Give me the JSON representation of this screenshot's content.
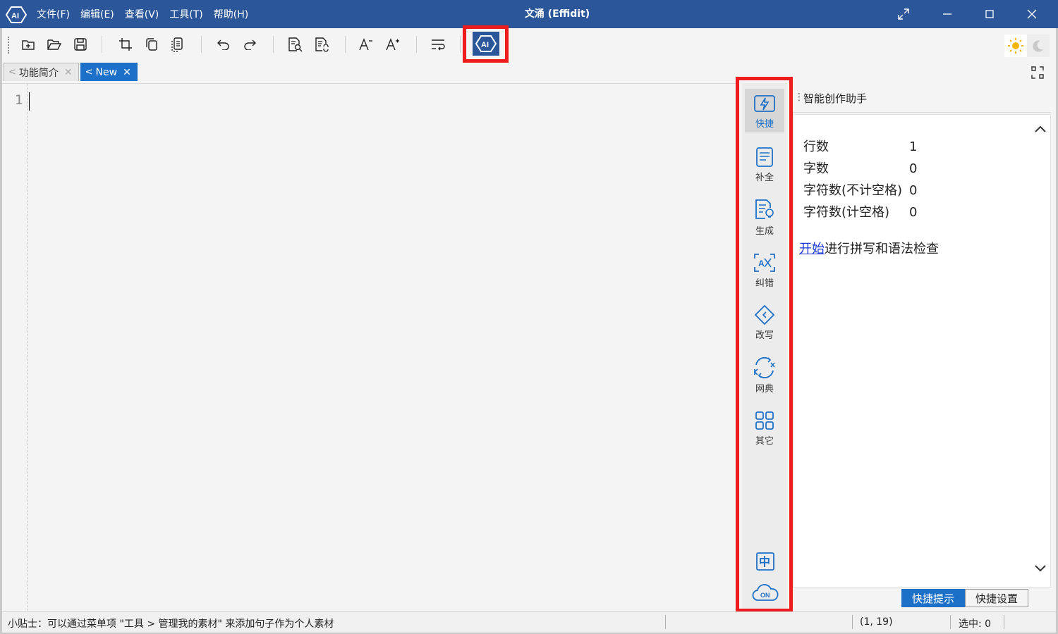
{
  "window": {
    "title": "文涌 (Effidit)",
    "menu": [
      "文件(F)",
      "编辑(E)",
      "查看(V)",
      "工具(T)",
      "帮助(H)"
    ]
  },
  "toolbar": {
    "buttons": [
      "new-file-icon",
      "open-folder-icon",
      "save-icon",
      "crop-icon",
      "copy-icon",
      "paste-icon",
      "undo-icon",
      "redo-icon",
      "find-icon",
      "replace-icon",
      "decrease-font-icon",
      "increase-font-icon",
      "word-wrap-icon",
      "ai-assistant-icon"
    ]
  },
  "tabs": [
    {
      "label": "功能简介",
      "active": false
    },
    {
      "label": "New",
      "active": true
    }
  ],
  "editor": {
    "line_numbers": [
      "1"
    ]
  },
  "rail": {
    "items": [
      {
        "label": "快捷",
        "icon": "lightning-icon",
        "active": true
      },
      {
        "label": "补全",
        "icon": "complete-icon",
        "active": false
      },
      {
        "label": "生成",
        "icon": "generate-icon",
        "active": false
      },
      {
        "label": "纠错",
        "icon": "correct-icon",
        "active": false
      },
      {
        "label": "改写",
        "icon": "rewrite-icon",
        "active": false
      },
      {
        "label": "网典",
        "icon": "dictionary-icon",
        "active": false
      },
      {
        "label": "其它",
        "icon": "grid-icon",
        "active": false
      }
    ],
    "bottom": {
      "lang_glyph": "中",
      "cloud_label": "ON"
    }
  },
  "panel": {
    "title": "智能创作助手",
    "stats": [
      {
        "label": "行数",
        "value": "1"
      },
      {
        "label": "字数",
        "value": "0"
      },
      {
        "label": "字符数(不计空格)",
        "value": "0"
      },
      {
        "label": "字符数(计空格)",
        "value": "0"
      }
    ],
    "check_link": "开始",
    "check_text": "进行拼写和语法检查",
    "tabs": [
      "快捷提示",
      "快捷设置"
    ]
  },
  "status": {
    "tip": "小贴士：可以通过菜单项 \"工具 > 管理我的素材\" 来添加句子作为个人素材",
    "position": "(1, 19)",
    "selection": "选中: 0"
  },
  "colors": {
    "title_bar": "#2b579a",
    "accent_blue": "#1d70c7",
    "highlight_red": "#ee1c1c"
  }
}
